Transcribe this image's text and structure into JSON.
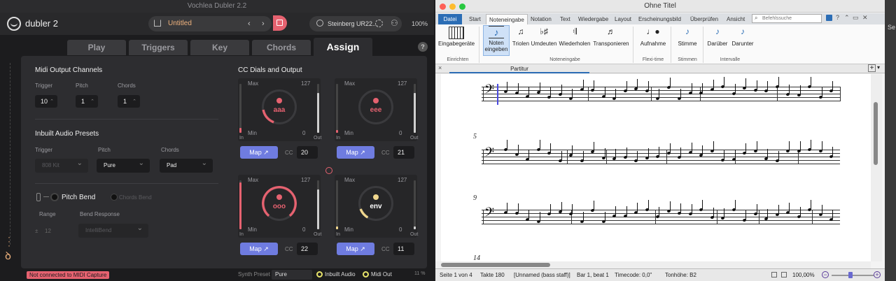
{
  "dubler": {
    "window_title": "Vochlea Dubler 2.2",
    "app_name": "dubler 2",
    "project_name": "Untitled",
    "nav_prev": "‹",
    "nav_next": "›",
    "device": "Steinberg UR22...",
    "zoom": "100%",
    "tabs": [
      {
        "label": "Play",
        "active": false
      },
      {
        "label": "Triggers",
        "active": false
      },
      {
        "label": "Key",
        "active": false
      },
      {
        "label": "Chords",
        "active": false
      },
      {
        "label": "Assign",
        "active": true
      }
    ],
    "help": "?",
    "midi_output": {
      "title": "Midi Output Channels",
      "trigger_label": "Trigger",
      "trigger_value": "10",
      "pitch_label": "Pitch",
      "pitch_value": "1",
      "chords_label": "Chords",
      "chords_value": "1"
    },
    "presets": {
      "title": "Inbuilt Audio Presets",
      "trigger_label": "Trigger",
      "trigger_value": "808 Kit",
      "pitch_label": "Pitch",
      "pitch_value": "Pure",
      "chords_label": "Chords",
      "chords_value": "Pad"
    },
    "pitch_bend": {
      "label": "Pitch Bend",
      "chords_bend": "Chords Bend",
      "range_label": "Range",
      "range_value": "12",
      "response_label": "Bend Response",
      "response_value": "IntelliBend"
    },
    "cc": {
      "title": "CC Dials and Output",
      "max": "Max",
      "min": "Min",
      "top_value": "127",
      "zero": "0",
      "in": "In",
      "out": "Out",
      "cc_label": "CC",
      "map_label": "Map ↗",
      "dials": [
        {
          "name": "aaa",
          "cc": "20"
        },
        {
          "name": "eee",
          "cc": "21"
        },
        {
          "name": "ooo",
          "cc": "22"
        },
        {
          "name": "env",
          "cc": "11"
        }
      ]
    },
    "status": {
      "error": "Not connected to MIDI Capture",
      "synth_label": "Synth Preset",
      "synth_value": "Pure",
      "inbuilt_audio": "Inbuilt Audio",
      "midi_out": "Midi Out",
      "cpu": "11 %"
    }
  },
  "finale": {
    "title": "Ohne Titel",
    "menu_tabs": [
      "Datei",
      "Start",
      "Noteneingabe",
      "Notation",
      "Text",
      "Wiedergabe",
      "Layout",
      "Erscheinungsbild",
      "Überprüfen",
      "Ansicht"
    ],
    "search_placeholder": "Befehlssuche",
    "ribbon": {
      "eingabegeraete": "Eingabegeräte",
      "noten_eingeben": "Noten eingeben",
      "triolen": "Triolen",
      "umdeuten": "Umdeuten",
      "wiederholen": "Wiederholen",
      "transponieren": "Transponieren",
      "aufnahme": "Aufnahme",
      "stimme": "Stimme",
      "darueber": "Darüber",
      "darunter": "Darunter",
      "group_einrichten": "Einrichten",
      "group_noteneingabe": "Noteneingabe",
      "group_flexitime": "Flexi-time",
      "group_stimmen": "Stimmen",
      "group_intervalle": "Intervalle"
    },
    "doc_tab": "Partitur",
    "measure_numbers": [
      "5",
      "9",
      "14"
    ],
    "status": {
      "page": "Seite 1 von 4",
      "takte": "Takte 180",
      "staff": "[Unnamed (bass staff)]",
      "bar": "Bar 1, beat 1",
      "timecode": "Timecode: 0,0\"",
      "tonhoehe": "Tonhöhe: B2",
      "zoom": "100,00%"
    }
  }
}
